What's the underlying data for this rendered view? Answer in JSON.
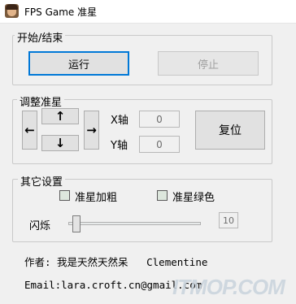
{
  "window": {
    "title": "FPS Game 准星",
    "icon": "avatar-portrait-icon"
  },
  "control_group": {
    "title": "开始/结束",
    "start_label": "运行",
    "stop_label": "停止",
    "stop_disabled": true
  },
  "adjust_group": {
    "title": "调整准星",
    "up_arrow": "↑",
    "down_arrow": "↓",
    "left_arrow": "←",
    "right_arrow": "→",
    "x_label": "X轴",
    "x_value": "0",
    "y_label": "Y轴",
    "y_value": "0",
    "reset_label": "复位"
  },
  "other_group": {
    "title": "其它设置",
    "bold_label": "准星加粗",
    "bold_checked": false,
    "green_label": "准星绿色",
    "green_checked": false,
    "blink_label": "闪烁",
    "blink_value": "10",
    "blink_level": 0
  },
  "footer": {
    "author_line": "作者: 我是天然天然呆   Clementine",
    "email_line": "Email:lara.croft.cn@gmail.com"
  },
  "watermark": "ITMOP.COM",
  "colors": {
    "focus_border": "#0078d7",
    "window_bg": "#f0f0f0",
    "checkbox_fill": "#dde7dd"
  }
}
